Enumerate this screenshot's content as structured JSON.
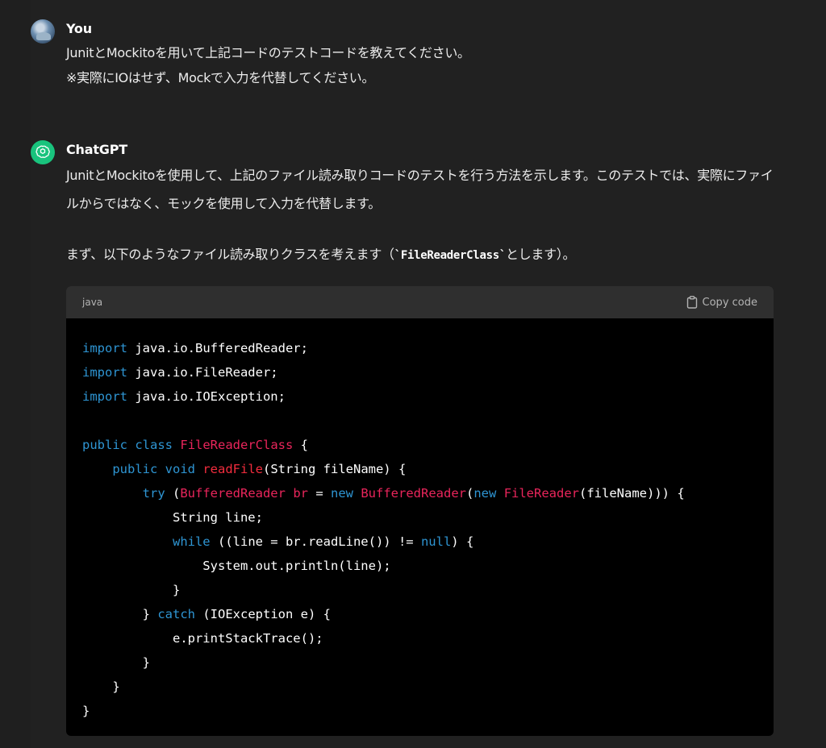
{
  "user": {
    "name": "You",
    "lines": [
      "JunitとMockitoを用いて上記コードのテストコードを教えてください。",
      "※実際にIOはせず、Mockで入力を代替してください。"
    ]
  },
  "assistant": {
    "name": "ChatGPT",
    "para1": "JunitとMockitoを使用して、上記のファイル読み取りコードのテストを行う方法を示します。このテストでは、実際にファイルからではなく、モックを使用して入力を代替します。",
    "para2_before": "まず、以下のようなファイル読み取りクラスを考えます（",
    "para2_code": "`FileReaderClass`",
    "para2_after": "とします）。"
  },
  "code_block": {
    "language": "java",
    "copy_label": "Copy code"
  },
  "code_lines": [
    [
      [
        "kw",
        "import"
      ],
      [
        "p",
        " java.io.BufferedReader;"
      ]
    ],
    [
      [
        "kw",
        "import"
      ],
      [
        "p",
        " java.io.FileReader;"
      ]
    ],
    [
      [
        "kw",
        "import"
      ],
      [
        "p",
        " java.io.IOException;"
      ]
    ],
    [
      [
        "p",
        ""
      ]
    ],
    [
      [
        "kw",
        "public"
      ],
      [
        "p",
        " "
      ],
      [
        "kw",
        "class"
      ],
      [
        "p",
        " "
      ],
      [
        "cls",
        "FileReaderClass"
      ],
      [
        "p",
        " {"
      ]
    ],
    [
      [
        "p",
        "    "
      ],
      [
        "kw",
        "public"
      ],
      [
        "p",
        " "
      ],
      [
        "kw",
        "void"
      ],
      [
        "p",
        " "
      ],
      [
        "fn",
        "readFile"
      ],
      [
        "p",
        "(String fileName) {"
      ]
    ],
    [
      [
        "p",
        "        "
      ],
      [
        "kw",
        "try"
      ],
      [
        "p",
        " ("
      ],
      [
        "cls",
        "BufferedReader"
      ],
      [
        "p",
        " "
      ],
      [
        "cls",
        "br"
      ],
      [
        "p",
        " = "
      ],
      [
        "kw",
        "new"
      ],
      [
        "p",
        " "
      ],
      [
        "cls",
        "BufferedReader"
      ],
      [
        "p",
        "("
      ],
      [
        "kw",
        "new"
      ],
      [
        "p",
        " "
      ],
      [
        "cls",
        "FileReader"
      ],
      [
        "p",
        "(fileName))) {"
      ]
    ],
    [
      [
        "p",
        "            String line;"
      ]
    ],
    [
      [
        "p",
        "            "
      ],
      [
        "kw",
        "while"
      ],
      [
        "p",
        " ((line = br.readLine()) != "
      ],
      [
        "kw",
        "null"
      ],
      [
        "p",
        ") {"
      ]
    ],
    [
      [
        "p",
        "                System.out.println(line);"
      ]
    ],
    [
      [
        "p",
        "            }"
      ]
    ],
    [
      [
        "p",
        "        } "
      ],
      [
        "kw",
        "catch"
      ],
      [
        "p",
        " (IOException e) {"
      ]
    ],
    [
      [
        "p",
        "            e.printStackTrace();"
      ]
    ],
    [
      [
        "p",
        "        }"
      ]
    ],
    [
      [
        "p",
        "    }"
      ]
    ],
    [
      [
        "p",
        "}"
      ]
    ]
  ],
  "icons": {
    "user_avatar": "user-avatar",
    "bot_avatar": "openai-logo-icon",
    "copy": "clipboard-icon"
  },
  "colors": {
    "keyword": "#2e95d3",
    "class": "#e9255b",
    "function": "#f22c3d",
    "bot_avatar_bg": "#19c37d"
  }
}
